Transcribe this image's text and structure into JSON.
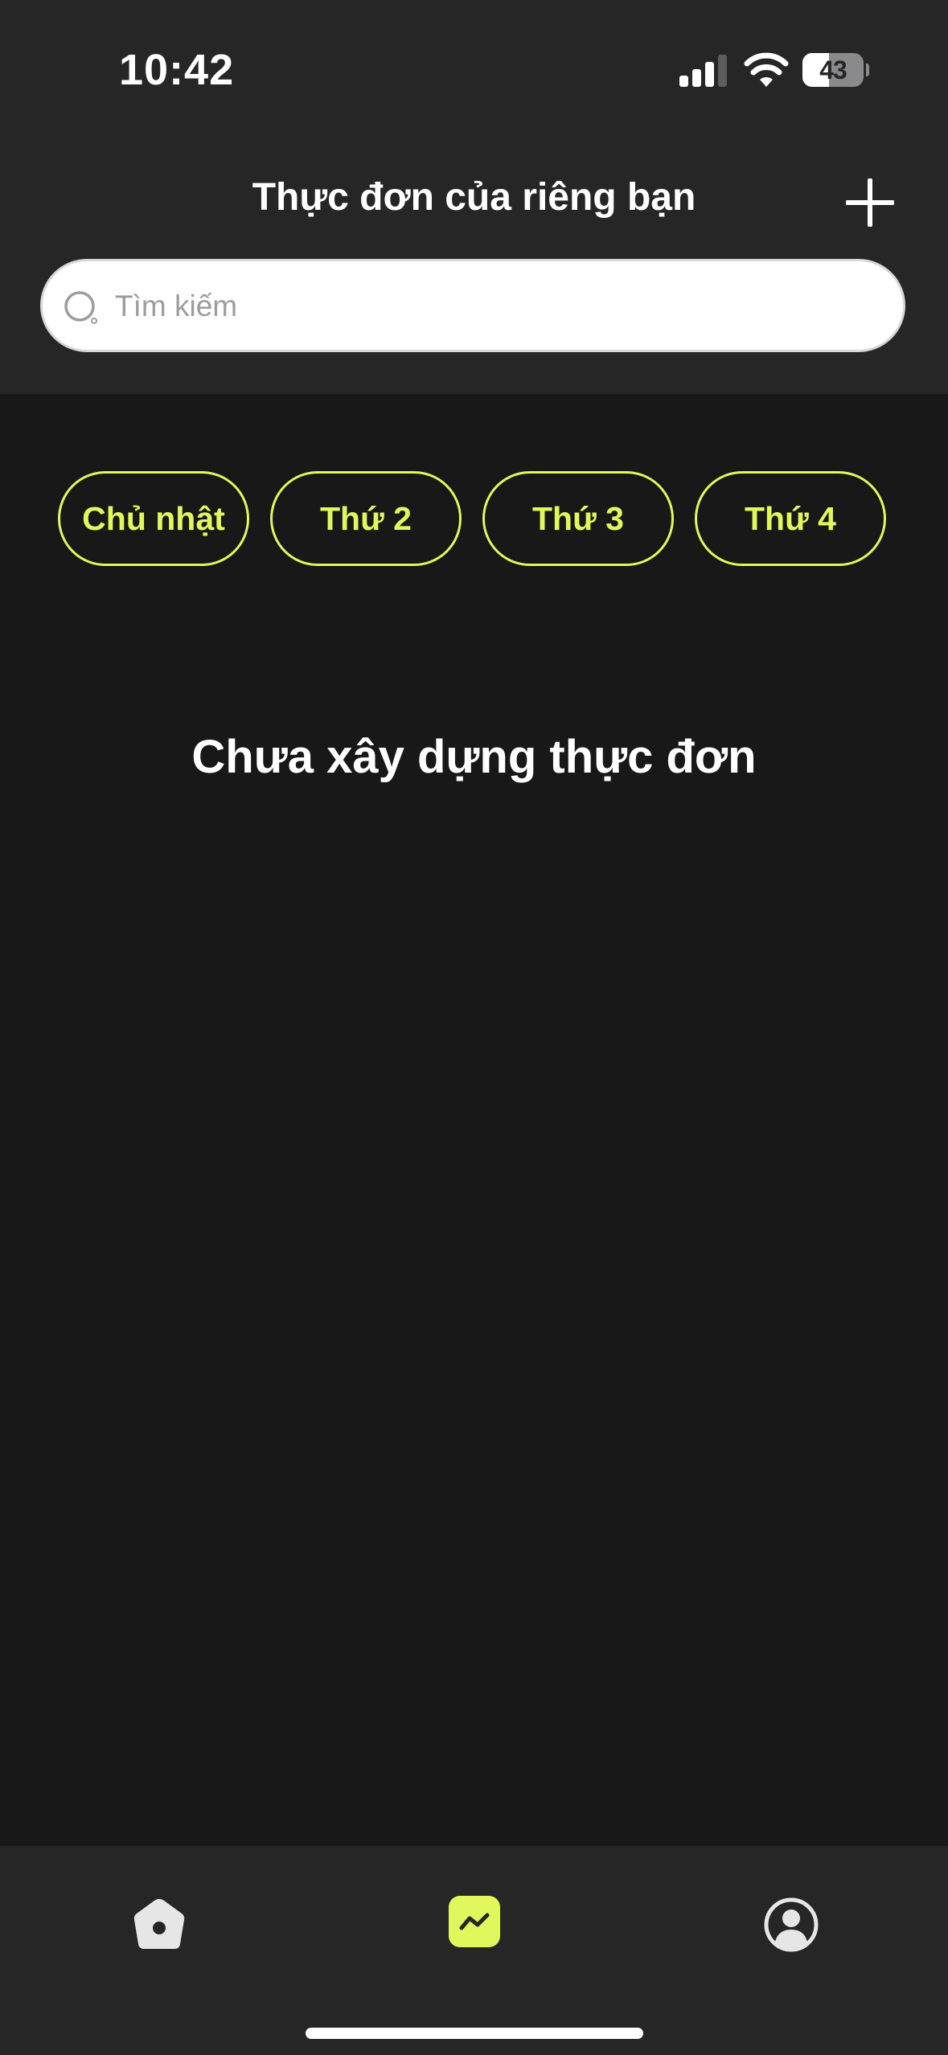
{
  "status_bar": {
    "time": "10:42",
    "battery_percent": 43,
    "battery_label": "43",
    "icons": [
      "cellular-signal-icon",
      "wifi-icon",
      "battery-icon"
    ]
  },
  "header": {
    "title": "Thực đơn của riêng bạn",
    "add_icon": "plus-icon"
  },
  "search": {
    "placeholder": "Tìm kiếm",
    "value": "",
    "icon": "search-icon"
  },
  "day_chips": [
    {
      "label": "Chủ nhật"
    },
    {
      "label": "Thứ 2"
    },
    {
      "label": "Thứ 3"
    },
    {
      "label": "Thứ 4"
    }
  ],
  "empty_state": {
    "message": "Chưa xây dựng thực đơn"
  },
  "tab_bar": {
    "tabs": [
      {
        "icon": "home-icon",
        "active": false
      },
      {
        "icon": "chart-icon",
        "active": true
      },
      {
        "icon": "profile-icon",
        "active": false
      }
    ]
  },
  "colors": {
    "accent": "#e2f75e",
    "background": "#181818",
    "header_background": "#262627",
    "text": "#ffffff"
  }
}
